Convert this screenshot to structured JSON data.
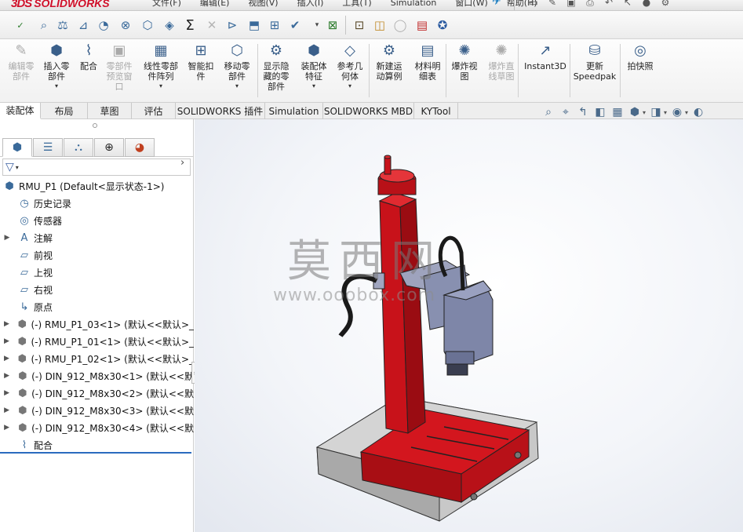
{
  "app": {
    "logo_ds": "3DS",
    "logo_text": "SOLIDWORKS"
  },
  "menu": [
    "文件(F)",
    "编辑(E)",
    "视图(V)",
    "插入(I)",
    "工具(T)",
    "Simulation",
    "窗口(W)",
    "帮助(H)"
  ],
  "ribbon": {
    "buttons": [
      {
        "label": "编辑零\n部件",
        "icon": "edit-component-icon",
        "disabled": true
      },
      {
        "label": "插入零\n部件",
        "icon": "insert-component-icon",
        "disabled": false
      },
      {
        "label": "配合",
        "icon": "mate-icon",
        "disabled": false
      },
      {
        "label": "零部件\n预览窗\n口",
        "icon": "component-preview-icon",
        "disabled": true
      },
      {
        "label": "线性零部\n件阵列",
        "icon": "linear-pattern-icon",
        "disabled": false
      },
      {
        "label": "智能扣\n件",
        "icon": "smart-fasteners-icon",
        "disabled": false
      },
      {
        "label": "移动零\n部件",
        "icon": "move-component-icon",
        "disabled": false
      },
      {
        "label": "显示隐\n藏的零\n部件",
        "icon": "show-hidden-icon",
        "disabled": false
      },
      {
        "label": "装配体\n特征",
        "icon": "assembly-features-icon",
        "disabled": false
      },
      {
        "label": "参考几\n何体",
        "icon": "reference-geometry-icon",
        "disabled": false
      },
      {
        "label": "新建运\n动算例",
        "icon": "motion-study-icon",
        "disabled": false
      },
      {
        "label": "材料明\n细表",
        "icon": "bom-icon",
        "disabled": false
      },
      {
        "label": "爆炸视\n图",
        "icon": "exploded-view-icon",
        "disabled": false
      },
      {
        "label": "爆炸直\n线草图",
        "icon": "explode-line-sketch-icon",
        "disabled": true
      },
      {
        "label": "Instant3D",
        "icon": "instant3d-icon",
        "disabled": false
      },
      {
        "label": "更新\nSpeedpak",
        "icon": "speedpak-icon",
        "disabled": false
      },
      {
        "label": "拍快照",
        "icon": "snapshot-icon",
        "disabled": false
      }
    ]
  },
  "tabs": [
    "装配体",
    "布局",
    "草图",
    "评估",
    "SOLIDWORKS 插件",
    "Simulation",
    "SOLIDWORKS MBD",
    "KYTool"
  ],
  "active_tab": "装配体",
  "tree": {
    "root": "RMU_P1  (Default<显示状态-1>)",
    "items": [
      {
        "label": "历史记录",
        "icon": "history-icon",
        "expandable": false
      },
      {
        "label": "传感器",
        "icon": "sensor-icon",
        "expandable": false
      },
      {
        "label": "注解",
        "icon": "annotations-icon",
        "expandable": true
      },
      {
        "label": "前视",
        "icon": "plane-icon",
        "expandable": false
      },
      {
        "label": "上视",
        "icon": "plane-icon",
        "expandable": false
      },
      {
        "label": "右视",
        "icon": "plane-icon",
        "expandable": false
      },
      {
        "label": "原点",
        "icon": "origin-icon",
        "expandable": false
      },
      {
        "label": "(-) RMU_P1_03<1> (默认<<默认>_",
        "icon": "part-icon",
        "expandable": true
      },
      {
        "label": "(-) RMU_P1_01<1> (默认<<默认>_",
        "icon": "part-icon",
        "expandable": true
      },
      {
        "label": "(-) RMU_P1_02<1> (默认<<默认>_",
        "icon": "part-icon",
        "expandable": true
      },
      {
        "label": "(-) DIN_912_M8x30<1> (默认<<默",
        "icon": "part-icon",
        "expandable": true
      },
      {
        "label": "(-) DIN_912_M8x30<2> (默认<<默",
        "icon": "part-icon",
        "expandable": true
      },
      {
        "label": "(-) DIN_912_M8x30<3> (默认<<默",
        "icon": "part-icon",
        "expandable": true
      },
      {
        "label": "(-) DIN_912_M8x30<4> (默认<<默",
        "icon": "part-icon",
        "expandable": true
      },
      {
        "label": "配合",
        "icon": "mates-icon",
        "expandable": false
      }
    ]
  },
  "viewport": {
    "watermark_cn": "莫西网",
    "watermark_url": "www.ooobox.com",
    "colors": {
      "body_red": "#c8121a",
      "base_gray": "#c9c9c9",
      "motor_blue": "#7d86a8"
    }
  }
}
